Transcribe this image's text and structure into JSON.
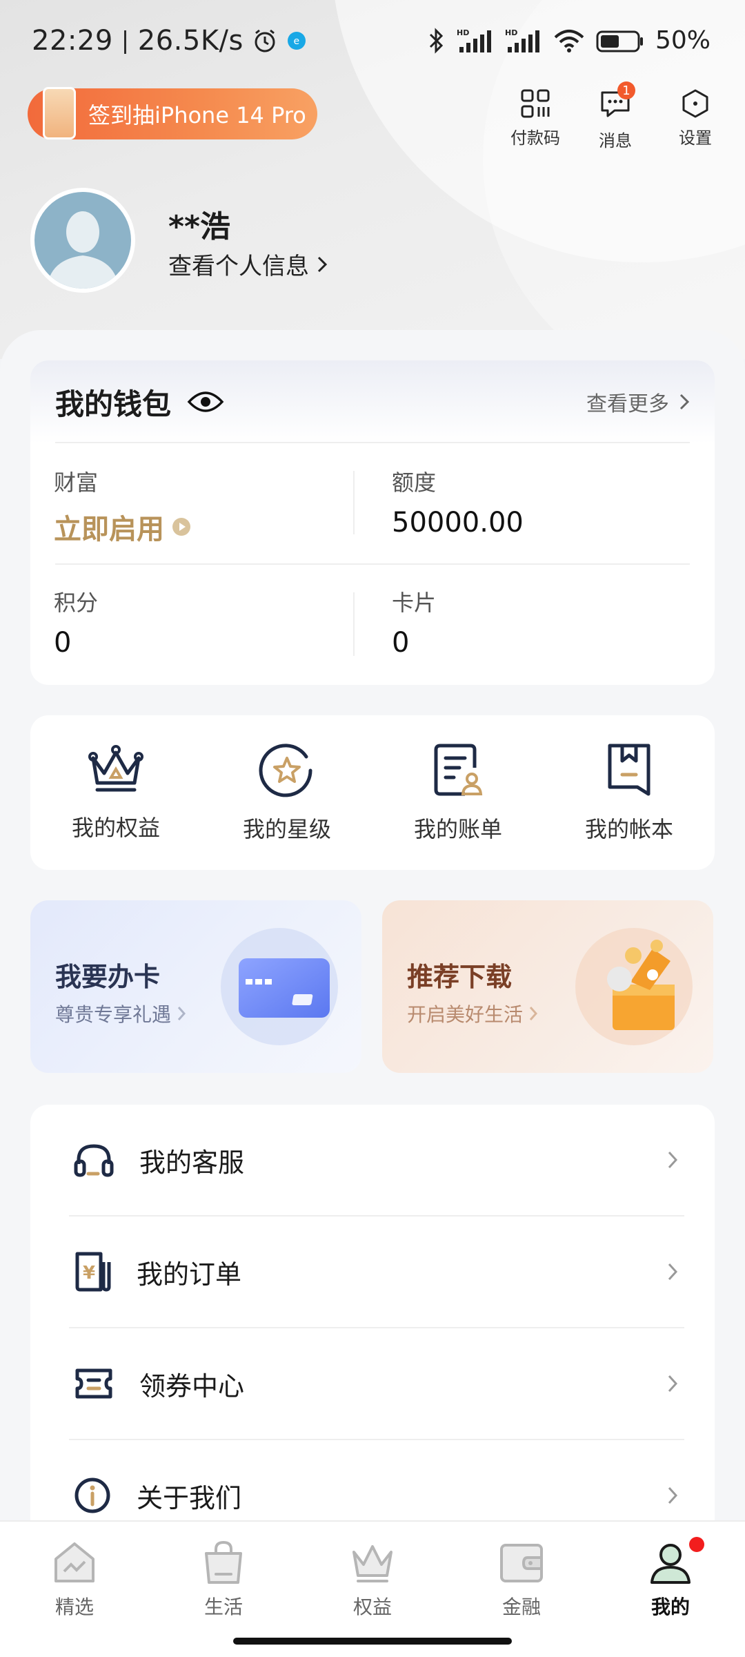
{
  "status_bar": {
    "time": "22:29",
    "net_speed": "26.5K/s",
    "battery_text": "50%"
  },
  "promo_banner": {
    "label": "签到抽iPhone 14 Pro"
  },
  "top_actions": [
    {
      "label": "付款码",
      "icon": "qr-code-icon"
    },
    {
      "label": "消息",
      "icon": "message-icon",
      "badge": "1"
    },
    {
      "label": "设置",
      "icon": "settings-icon"
    }
  ],
  "profile": {
    "name": "**浩",
    "view_info": "查看个人信息"
  },
  "wallet": {
    "title": "我的钱包",
    "more": "查看更多",
    "items": [
      {
        "label": "财富",
        "value": "立即启用"
      },
      {
        "label": "额度",
        "value": "50000.00"
      },
      {
        "label": "积分",
        "value": "0"
      },
      {
        "label": "卡片",
        "value": "0"
      }
    ],
    "accent_color": "#b8935a"
  },
  "quick_actions": [
    {
      "label": "我的权益",
      "icon": "crown-icon"
    },
    {
      "label": "我的星级",
      "icon": "star-icon"
    },
    {
      "label": "我的账单",
      "icon": "bill-icon"
    },
    {
      "label": "我的帐本",
      "icon": "bookmark-icon"
    }
  ],
  "tiles": [
    {
      "title": "我要办卡",
      "subtitle": "尊贵专享礼遇"
    },
    {
      "title": "推荐下载",
      "subtitle": "开启美好生活"
    }
  ],
  "menu": [
    {
      "label": "我的客服",
      "icon": "headset-icon"
    },
    {
      "label": "我的订单",
      "icon": "order-icon"
    },
    {
      "label": "领券中心",
      "icon": "coupon-icon"
    },
    {
      "label": "关于我们",
      "icon": "info-icon"
    }
  ],
  "bottom_nav": [
    {
      "label": "精选",
      "icon": "home-icon"
    },
    {
      "label": "生活",
      "icon": "bag-icon"
    },
    {
      "label": "权益",
      "icon": "crown-icon"
    },
    {
      "label": "金融",
      "icon": "wallet-icon"
    },
    {
      "label": "我的",
      "icon": "user-icon",
      "active": true
    }
  ]
}
